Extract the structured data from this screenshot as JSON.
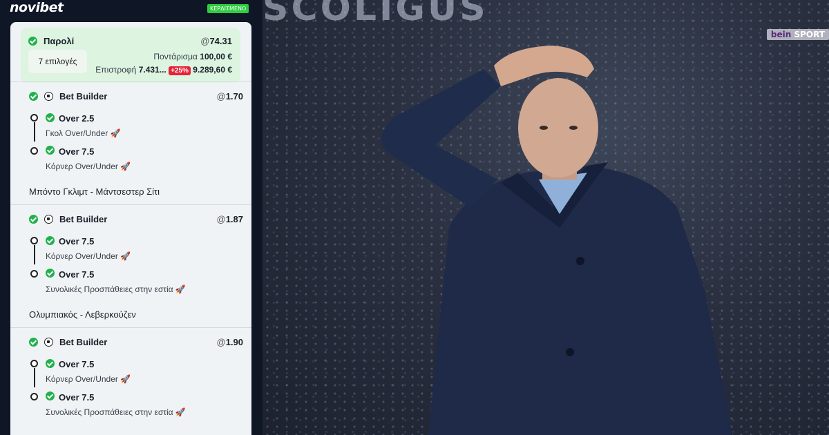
{
  "brand": {
    "logo_text": "novibet",
    "status_badge": "ΚΕΡΔΙΣΜΕΝΟ"
  },
  "summary": {
    "title": "Παρολί",
    "odds_prefix": "@",
    "odds": "74.31",
    "selections": "7 επιλογές",
    "stake_label": "Ποντάρισμα",
    "stake_value": "100,00 €",
    "return_label": "Επιστροφή",
    "return_value": "7.431...",
    "boost": "+25%",
    "boosted_return": "9.289,60 €"
  },
  "bets": [
    {
      "type": "Bet Builder",
      "odds": "1.70",
      "legs": [
        {
          "pick": "Over 2.5",
          "market": "Γκολ Over/Under 🚀"
        },
        {
          "pick": "Over 7.5",
          "market": "Κόρνερ Over/Under 🚀"
        }
      ],
      "match": "Μπόντο Γκλιμτ - Μάντσεστερ Σίτι"
    },
    {
      "type": "Bet Builder",
      "odds": "1.87",
      "legs": [
        {
          "pick": "Over 7.5",
          "market": "Κόρνερ Over/Under 🚀"
        },
        {
          "pick": "Over 7.5",
          "market": "Συνολικές Προσπάθειες στην εστία 🚀"
        }
      ],
      "match": "Ολυμπιακός - Λεβερκούζεν"
    },
    {
      "type": "Bet Builder",
      "odds": "1.90",
      "legs": [
        {
          "pick": "Over 7.5",
          "market": "Κόρνερ Over/Under 🚀"
        },
        {
          "pick": "Over 7.5",
          "market": "Συνολικές Προσπάθειες στην εστία 🚀"
        }
      ]
    }
  ],
  "photo": {
    "stadium_text": "SCOLIGUS",
    "broadcaster": "bein",
    "broadcaster_suffix": "SPORT"
  },
  "colors": {
    "accent_green": "#22b14c",
    "boost_red": "#e5223a",
    "panel_bg": "#0f1625"
  }
}
